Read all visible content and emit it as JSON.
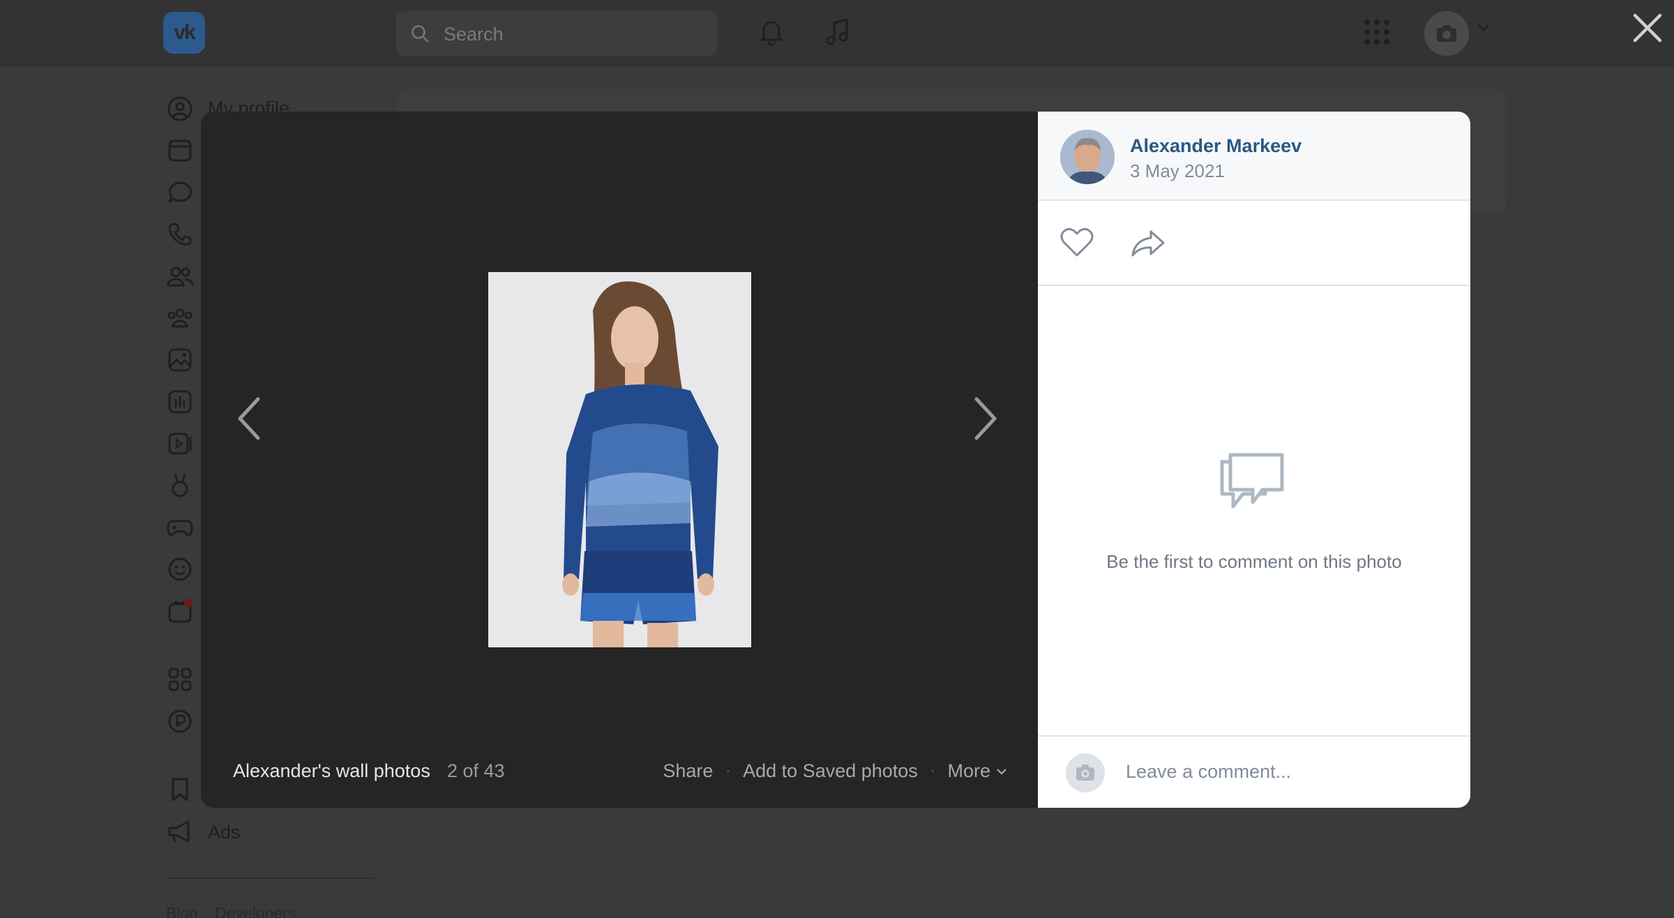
{
  "background": {
    "search_placeholder": "Search",
    "sidebar": {
      "profile_label": "My profile",
      "ads_label": "Ads"
    },
    "footer": {
      "blog": "Blog",
      "developers": "Developers"
    },
    "logo_text": "vk"
  },
  "viewer": {
    "album_title": "Alexander's wall photos",
    "position": "2 of 43",
    "share_label": "Share",
    "save_label": "Add to Saved photos",
    "more_label": "More"
  },
  "panel": {
    "author_name": "Alexander Markeev",
    "date": "3 May 2021",
    "empty_text": "Be the first to comment on this photo",
    "comment_placeholder": "Leave a comment..."
  },
  "icons": {
    "like": "heart-icon",
    "share": "share-arrow-icon",
    "close": "close-icon",
    "comments_empty": "comments-icon",
    "camera": "camera-icon"
  },
  "colors": {
    "accent_link": "#2a5885",
    "secondary_text": "#818c99",
    "modal_dark": "#252525",
    "overlay": "#3a3a3a"
  }
}
